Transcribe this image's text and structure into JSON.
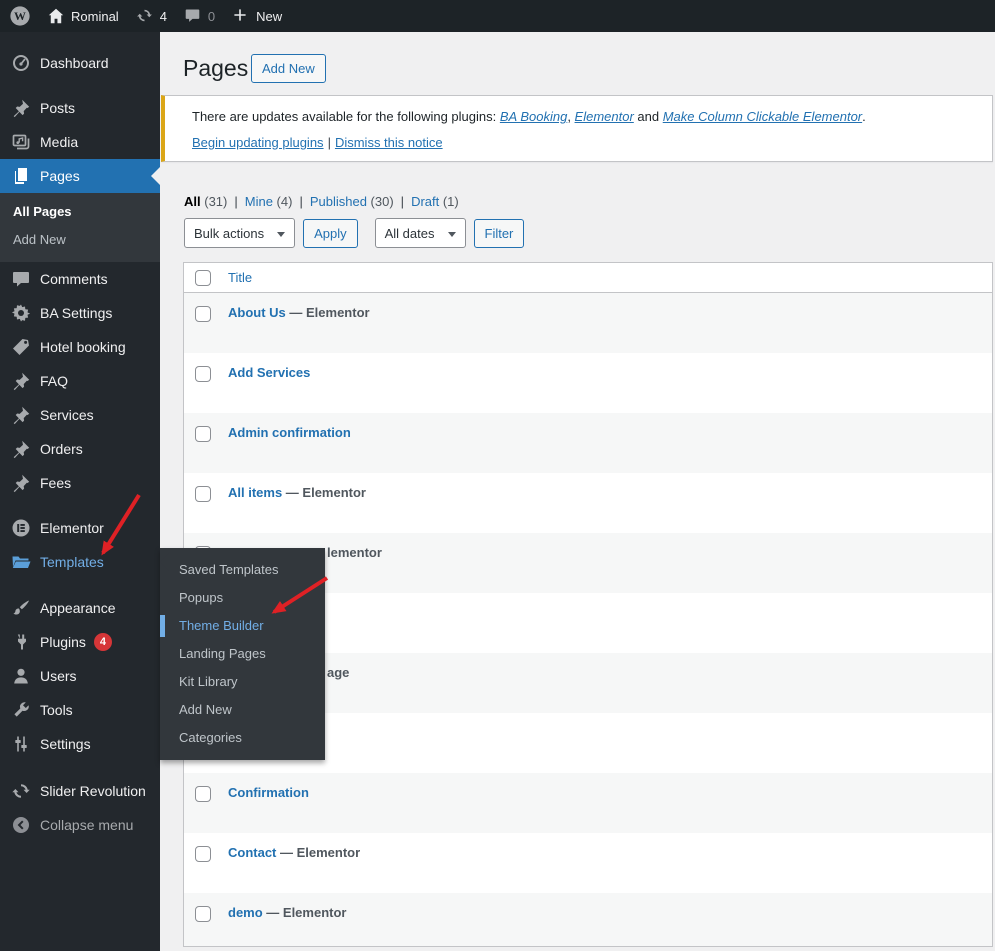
{
  "admin_bar": {
    "site_name": "Rominal",
    "update_count": "4",
    "comment_count": "0",
    "new_label": "New"
  },
  "sidebar": {
    "sections": [
      {
        "items": [
          {
            "label": "Dashboard",
            "icon": "dashboard"
          }
        ]
      },
      {
        "items": [
          {
            "label": "Posts",
            "icon": "pin"
          },
          {
            "label": "Media",
            "icon": "media"
          },
          {
            "label": "Pages",
            "icon": "pages",
            "active": true,
            "submenu": [
              {
                "label": "All Pages",
                "current": true
              },
              {
                "label": "Add New"
              }
            ]
          },
          {
            "label": "Comments",
            "icon": "comment"
          },
          {
            "label": "BA Settings",
            "icon": "gear"
          },
          {
            "label": "Hotel booking",
            "icon": "tag"
          },
          {
            "label": "FAQ",
            "icon": "pin"
          },
          {
            "label": "Services",
            "icon": "pin"
          },
          {
            "label": "Orders",
            "icon": "pin"
          },
          {
            "label": "Fees",
            "icon": "pin"
          }
        ]
      },
      {
        "items": [
          {
            "label": "Elementor",
            "icon": "elementor"
          },
          {
            "label": "Templates",
            "icon": "folder",
            "highlight": true
          }
        ]
      },
      {
        "items": [
          {
            "label": "Appearance",
            "icon": "brush"
          },
          {
            "label": "Plugins",
            "icon": "plug",
            "badge": "4"
          },
          {
            "label": "Users",
            "icon": "user"
          },
          {
            "label": "Tools",
            "icon": "wrench"
          },
          {
            "label": "Settings",
            "icon": "sliders"
          }
        ]
      },
      {
        "items": [
          {
            "label": "Slider Revolution",
            "icon": "update"
          },
          {
            "label": "Collapse menu",
            "icon": "collapse",
            "dim": true
          }
        ]
      }
    ]
  },
  "flyout": {
    "items": [
      {
        "label": "Saved Templates"
      },
      {
        "label": "Popups"
      },
      {
        "label": "Theme Builder",
        "current": true
      },
      {
        "label": "Landing Pages"
      },
      {
        "label": "Kit Library"
      },
      {
        "label": "Add New"
      },
      {
        "label": "Categories"
      }
    ]
  },
  "page": {
    "title": "Pages",
    "add_new_label": "Add New"
  },
  "notice": {
    "text": "There are updates available for the following plugins: ",
    "plugin_links": [
      "BA Booking",
      "Elementor",
      "Make Column Clickable Elementor"
    ],
    "sep1": ", ",
    "sep2": " and ",
    "period": ".",
    "action_update": "Begin updating plugins",
    "divider": "|",
    "action_dismiss": "Dismiss this notice"
  },
  "filters": {
    "views": [
      {
        "label": "All",
        "count": "(31)",
        "current": true
      },
      {
        "label": "Mine",
        "count": "(4)"
      },
      {
        "label": "Published",
        "count": "(30)"
      },
      {
        "label": "Draft",
        "count": "(1)"
      }
    ],
    "bulk_actions_label": "Bulk actions",
    "apply_label": "Apply",
    "dates_label": "All dates",
    "filter_label": "Filter"
  },
  "table": {
    "title_header": "Title",
    "rows": [
      {
        "title": "About Us",
        "state": "— Elementor"
      },
      {
        "title": "Add Services"
      },
      {
        "title": "Admin confirmation"
      },
      {
        "title": "All items",
        "state": "— Elementor"
      },
      {
        "fragment": "lementor"
      },
      {
        "covered": true
      },
      {
        "fragment": "age"
      },
      {
        "covered": true
      },
      {
        "title": "Confirmation"
      },
      {
        "title": "Contact",
        "state": "— Elementor"
      },
      {
        "title": "demo",
        "state": "— Elementor"
      }
    ]
  },
  "colors": {
    "accent": "#2271b1",
    "highlight": "#72aee6",
    "notice_border": "#dba617",
    "badge": "#d63638",
    "arrow": "#df2125"
  }
}
